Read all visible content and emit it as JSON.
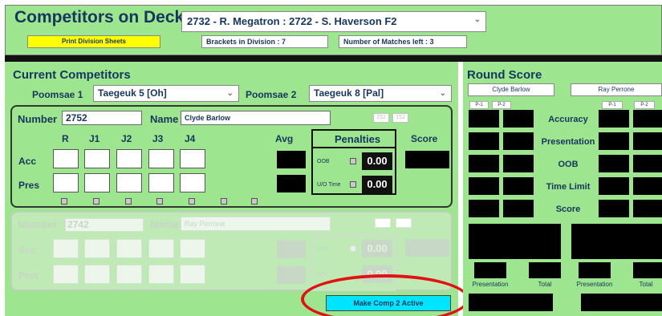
{
  "header": {
    "title": "Competitors on Deck:",
    "deck_selection": "2732 - R. Megatron  : 2722 - S. Haverson  F2",
    "print_button": "Print Division Sheets",
    "brackets_label": "Brackets in Division   : 7",
    "matches_label": "Number of Matches left : 3"
  },
  "current": {
    "title": "Current Competitors",
    "poomsae1_label": "Poomsae 1",
    "poomsae1_value": "Taegeuk 5 [Oh]",
    "poomsae2_label": "Poomsae 2",
    "poomsae2_value": "Taegeuk 8 [Pal]"
  },
  "comp1": {
    "number_label": "Number",
    "number": "2752",
    "name_label": "Name",
    "name": "Clyde Barlow",
    "btn_a": "152",
    "btn_b": "152",
    "cols": [
      "R",
      "J1",
      "J2",
      "J3",
      "J4"
    ],
    "avg_label": "Avg",
    "penalties_label": "Penalties",
    "score_label": "Score",
    "acc_label": "Acc",
    "pres_label": "Pres",
    "oob_label": "OOB",
    "oob_value": "0.00",
    "uo_label": "U/O Time",
    "uo_value": "0.00"
  },
  "comp2": {
    "number_label": "Number",
    "number": "2742",
    "name_label": "Name",
    "name": "Ray Perrone",
    "acc_label": "Acc",
    "pres_label": "Pres",
    "oob_label": "OOB",
    "oob_value": "0.00",
    "uo_label": "U/O",
    "uo_value": "0.00"
  },
  "activate_button": "Make Comp 2 Active",
  "round": {
    "title": "Round Score",
    "name1": "Clyde Barlow",
    "name2": "Ray Perrone",
    "p1": "P-1",
    "p2": "P-2",
    "rows": [
      "Accuracy",
      "Presentation",
      "OOB",
      "Time Limit",
      "Score"
    ],
    "foot_presentation": "Presentation",
    "foot_total": "Total"
  }
}
